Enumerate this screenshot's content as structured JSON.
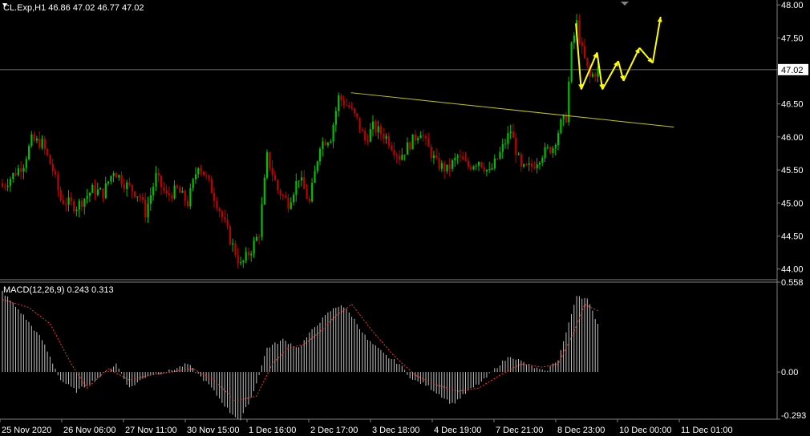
{
  "header": {
    "main_title": "CL.Exp,H1  46.86 47.02 46.77 47.02",
    "macd_title": "MACD(12,26,9) 0.243 0.313"
  },
  "colors": {
    "background": "#000000",
    "bull_candle": "#00c000",
    "bear_candle": "#c00000",
    "trendline": "#c8c800",
    "arrows": "#ffff00",
    "histogram": "#c0c0c0",
    "signal": "#ff3030",
    "axis": "#808080"
  },
  "chart_data": [
    {
      "type": "candlestick",
      "symbol": "CL.Exp",
      "timeframe": "H1",
      "ylim": [
        43.85,
        48.05
      ],
      "yticks": [
        "48.00",
        "47.50",
        "47.02",
        "46.50",
        "46.00",
        "45.50",
        "45.00",
        "44.50",
        "44.00"
      ],
      "current_price": "47.02",
      "xticks": [
        "25 Nov 2020",
        "26 Nov 06:00",
        "27 Nov 11:00",
        "30 Nov 15:00",
        "1 Dec 16:00",
        "2 Dec 17:00",
        "3 Dec 18:00",
        "4 Dec 19:00",
        "7 Dec 21:00",
        "8 Dec 23:00",
        "10 Dec 00:00",
        "11 Dec 01:00"
      ],
      "trend_line": {
        "from": {
          "bar": 132,
          "price": 46.67
        },
        "to": {
          "bar": 254,
          "price": 46.15
        }
      },
      "projection_path": [
        {
          "bar": 217,
          "price": 47.72
        },
        {
          "bar": 219,
          "price": 46.72
        },
        {
          "bar": 225,
          "price": 47.28
        },
        {
          "bar": 227,
          "price": 46.72
        },
        {
          "bar": 233,
          "price": 47.15
        },
        {
          "bar": 235,
          "price": 46.85
        },
        {
          "bar": 241,
          "price": 47.35
        },
        {
          "bar": 246,
          "price": 47.12
        },
        {
          "bar": 249,
          "price": 47.82
        }
      ],
      "series": [
        {
          "name": "close",
          "anchors": [
            [
              0,
              45.25
            ],
            [
              8,
              45.6
            ],
            [
              11,
              45.95
            ],
            [
              15,
              45.9
            ],
            [
              19,
              45.5
            ],
            [
              22,
              45.05
            ],
            [
              28,
              44.95
            ],
            [
              34,
              45.2
            ],
            [
              38,
              45.15
            ],
            [
              42,
              45.5
            ],
            [
              46,
              45.3
            ],
            [
              52,
              45.1
            ],
            [
              54,
              44.85
            ],
            [
              58,
              45.4
            ],
            [
              62,
              45.1
            ],
            [
              66,
              45.2
            ],
            [
              70,
              45.0
            ],
            [
              74,
              45.6
            ],
            [
              78,
              45.3
            ],
            [
              82,
              44.9
            ],
            [
              86,
              44.45
            ],
            [
              90,
              44.05
            ],
            [
              94,
              44.3
            ],
            [
              97,
              44.55
            ],
            [
              100,
              45.7
            ],
            [
              104,
              45.2
            ],
            [
              108,
              45.0
            ],
            [
              112,
              45.4
            ],
            [
              116,
              45.0
            ],
            [
              120,
              45.9
            ],
            [
              124,
              46.0
            ],
            [
              127,
              46.6
            ],
            [
              131,
              46.45
            ],
            [
              134,
              46.25
            ],
            [
              137,
              45.95
            ],
            [
              140,
              46.15
            ],
            [
              145,
              46.0
            ],
            [
              150,
              45.7
            ],
            [
              155,
              45.95
            ],
            [
              158,
              46.1
            ],
            [
              160,
              45.9
            ],
            [
              164,
              45.6
            ],
            [
              168,
              45.5
            ],
            [
              172,
              45.7
            ],
            [
              176,
              45.55
            ],
            [
              180,
              45.65
            ],
            [
              184,
              45.45
            ],
            [
              188,
              45.75
            ],
            [
              192,
              46.1
            ],
            [
              196,
              45.5
            ],
            [
              200,
              45.55
            ],
            [
              204,
              45.75
            ],
            [
              208,
              45.85
            ],
            [
              211,
              46.2
            ],
            [
              213,
              46.3
            ],
            [
              215,
              47.35
            ],
            [
              217,
              47.72
            ],
            [
              219,
              47.3
            ],
            [
              222,
              46.9
            ],
            [
              225,
              47.02
            ]
          ]
        },
        {
          "name": "MACD",
          "anchors": [
            [
              0,
              0.5
            ],
            [
              8,
              0.35
            ],
            [
              15,
              0.2
            ],
            [
              22,
              -0.05
            ],
            [
              28,
              -0.12
            ],
            [
              35,
              -0.05
            ],
            [
              43,
              0.05
            ],
            [
              48,
              -0.1
            ],
            [
              55,
              -0.02
            ],
            [
              62,
              0.0
            ],
            [
              70,
              0.05
            ],
            [
              78,
              -0.08
            ],
            [
              86,
              -0.25
            ],
            [
              90,
              -0.3
            ],
            [
              95,
              -0.12
            ],
            [
              100,
              0.15
            ],
            [
              106,
              0.2
            ],
            [
              112,
              0.15
            ],
            [
              118,
              0.28
            ],
            [
              124,
              0.38
            ],
            [
              128,
              0.42
            ],
            [
              132,
              0.35
            ],
            [
              138,
              0.2
            ],
            [
              145,
              0.1
            ],
            [
              150,
              0.05
            ],
            [
              155,
              -0.05
            ],
            [
              160,
              -0.08
            ],
            [
              166,
              -0.15
            ],
            [
              170,
              -0.2
            ],
            [
              176,
              -0.12
            ],
            [
              182,
              -0.05
            ],
            [
              188,
              0.05
            ],
            [
              192,
              0.1
            ],
            [
              198,
              0.05
            ],
            [
              205,
              0.0
            ],
            [
              210,
              0.08
            ],
            [
              214,
              0.3
            ],
            [
              217,
              0.48
            ],
            [
              221,
              0.45
            ],
            [
              225,
              0.3
            ]
          ]
        },
        {
          "name": "Signal",
          "anchors": [
            [
              0,
              0.45
            ],
            [
              10,
              0.4
            ],
            [
              18,
              0.3
            ],
            [
              26,
              0.05
            ],
            [
              32,
              -0.1
            ],
            [
              40,
              0.02
            ],
            [
              48,
              -0.05
            ],
            [
              56,
              -0.02
            ],
            [
              64,
              0.0
            ],
            [
              72,
              0.02
            ],
            [
              80,
              -0.05
            ],
            [
              88,
              -0.18
            ],
            [
              96,
              -0.15
            ],
            [
              102,
              0.05
            ],
            [
              108,
              0.15
            ],
            [
              114,
              0.17
            ],
            [
              120,
              0.25
            ],
            [
              126,
              0.35
            ],
            [
              132,
              0.42
            ],
            [
              140,
              0.25
            ],
            [
              148,
              0.1
            ],
            [
              156,
              -0.02
            ],
            [
              164,
              -0.08
            ],
            [
              172,
              -0.12
            ],
            [
              180,
              -0.1
            ],
            [
              188,
              -0.02
            ],
            [
              196,
              0.05
            ],
            [
              204,
              0.03
            ],
            [
              210,
              0.05
            ],
            [
              216,
              0.25
            ],
            [
              220,
              0.42
            ],
            [
              225,
              0.38
            ]
          ]
        }
      ]
    },
    {
      "type": "bar",
      "name": "MACD(12,26,9)",
      "ylim": [
        -0.293,
        0.558
      ],
      "yticks": [
        "0.558",
        "0.00",
        "-0.293"
      ]
    }
  ]
}
